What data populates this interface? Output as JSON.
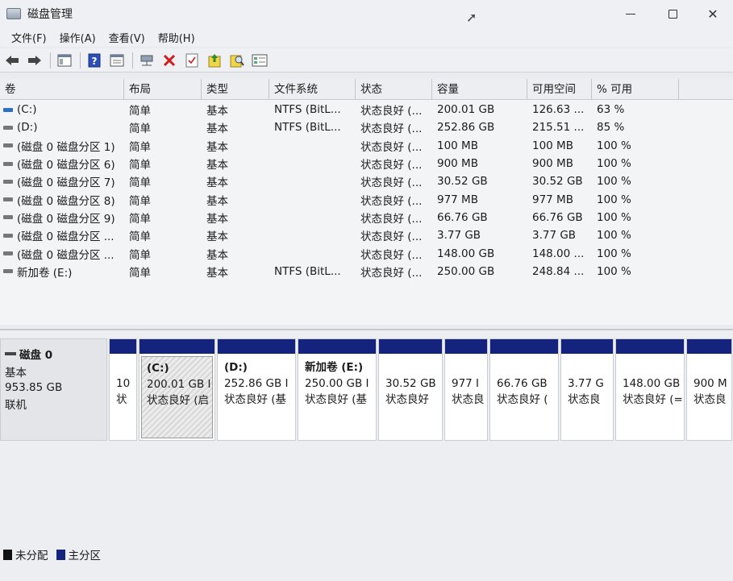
{
  "window": {
    "title": "磁盘管理"
  },
  "menu": [
    "文件(F)",
    "操作(A)",
    "查看(V)",
    "帮助(H)"
  ],
  "toolbar": [
    "back-icon",
    "forward-icon",
    "console-tree-icon",
    "help-icon",
    "properties-icon",
    "connect-icon",
    "delete-icon",
    "checklist-icon",
    "import-icon",
    "search-icon",
    "list-view-icon"
  ],
  "columns": [
    "卷",
    "布局",
    "类型",
    "文件系统",
    "状态",
    "容量",
    "可用空间",
    "% 可用"
  ],
  "volumes": [
    {
      "name": "(C:)",
      "layout": "简单",
      "type": "基本",
      "fs": "NTFS (BitL...",
      "status": "状态良好 (...",
      "capacity": "200.01 GB",
      "free": "126.63 ...",
      "pct": "63 %",
      "icon": "blue"
    },
    {
      "name": "(D:)",
      "layout": "简单",
      "type": "基本",
      "fs": "NTFS (BitL...",
      "status": "状态良好 (...",
      "capacity": "252.86 GB",
      "free": "215.51 ...",
      "pct": "85 %",
      "icon": "gray"
    },
    {
      "name": "(磁盘 0 磁盘分区 1)",
      "layout": "简单",
      "type": "基本",
      "fs": "",
      "status": "状态良好 (...",
      "capacity": "100 MB",
      "free": "100 MB",
      "pct": "100 %",
      "icon": "gray"
    },
    {
      "name": "(磁盘 0 磁盘分区 6)",
      "layout": "简单",
      "type": "基本",
      "fs": "",
      "status": "状态良好 (...",
      "capacity": "900 MB",
      "free": "900 MB",
      "pct": "100 %",
      "icon": "gray"
    },
    {
      "name": "(磁盘 0 磁盘分区 7)",
      "layout": "简单",
      "type": "基本",
      "fs": "",
      "status": "状态良好 (...",
      "capacity": "30.52 GB",
      "free": "30.52 GB",
      "pct": "100 %",
      "icon": "gray"
    },
    {
      "name": "(磁盘 0 磁盘分区 8)",
      "layout": "简单",
      "type": "基本",
      "fs": "",
      "status": "状态良好 (...",
      "capacity": "977 MB",
      "free": "977 MB",
      "pct": "100 %",
      "icon": "gray"
    },
    {
      "name": "(磁盘 0 磁盘分区 9)",
      "layout": "简单",
      "type": "基本",
      "fs": "",
      "status": "状态良好 (...",
      "capacity": "66.76 GB",
      "free": "66.76 GB",
      "pct": "100 %",
      "icon": "gray"
    },
    {
      "name": "(磁盘 0 磁盘分区 ...",
      "layout": "简单",
      "type": "基本",
      "fs": "",
      "status": "状态良好 (...",
      "capacity": "3.77 GB",
      "free": "3.77 GB",
      "pct": "100 %",
      "icon": "gray"
    },
    {
      "name": "(磁盘 0 磁盘分区 ...",
      "layout": "简单",
      "type": "基本",
      "fs": "",
      "status": "状态良好 (...",
      "capacity": "148.00 GB",
      "free": "148.00 ...",
      "pct": "100 %",
      "icon": "gray"
    },
    {
      "name": "新加卷 (E:)",
      "layout": "简单",
      "type": "基本",
      "fs": "NTFS (BitL...",
      "status": "状态良好 (...",
      "capacity": "250.00 GB",
      "free": "248.84 ...",
      "pct": "100 %",
      "icon": "gray"
    }
  ],
  "disk": {
    "name": "磁盘 0",
    "type": "基本",
    "size": "953.85 GB",
    "state": "联机"
  },
  "partitions": [
    {
      "name": "",
      "size": "10",
      "status": "状"
    },
    {
      "name": "(C:)",
      "size": "200.01 GB I",
      "status": "状态良好 (启",
      "selected": true
    },
    {
      "name": "(D:)",
      "size": "252.86 GB I",
      "status": "状态良好 (基"
    },
    {
      "name": "新加卷 (E:)",
      "size": "250.00 GB I",
      "status": "状态良好 (基"
    },
    {
      "name": "",
      "size": "30.52 GB",
      "status": "状态良好"
    },
    {
      "name": "",
      "size": "977 I",
      "status": "状态良"
    },
    {
      "name": "",
      "size": "66.76 GB",
      "status": "状态良好 ("
    },
    {
      "name": "",
      "size": "3.77 G",
      "status": "状态良"
    },
    {
      "name": "",
      "size": "148.00 GB",
      "status": "状态良好 (="
    },
    {
      "name": "",
      "size": "900 M",
      "status": "状态良"
    }
  ],
  "legend": [
    {
      "label": "未分配",
      "color": "#111111"
    },
    {
      "label": "主分区",
      "color": "#14237e"
    }
  ]
}
